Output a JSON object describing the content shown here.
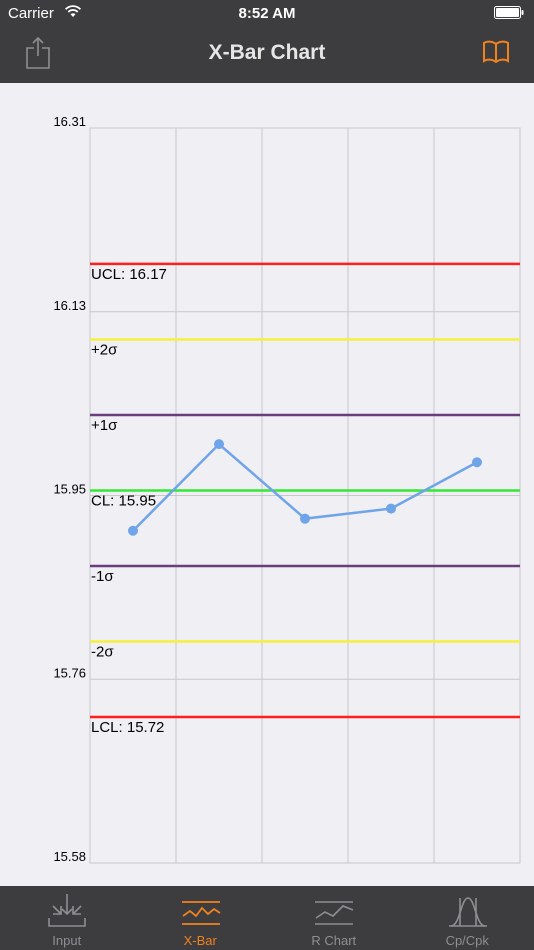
{
  "status_bar": {
    "carrier": "Carrier",
    "time": "8:52 AM"
  },
  "nav": {
    "title": "X-Bar Chart",
    "left_icon": "share-icon",
    "right_icon": "book-icon"
  },
  "chart_data": {
    "type": "line",
    "title": "",
    "y_ticks": [
      "16.31",
      "16.13",
      "15.95",
      "15.76",
      "15.58"
    ],
    "ylim": [
      15.58,
      16.31
    ],
    "x": [
      1,
      2,
      3,
      4,
      5
    ],
    "values": [
      15.91,
      15.996,
      15.922,
      15.932,
      15.978
    ],
    "grid": true,
    "control_lines": [
      {
        "label": "UCL: 16.17",
        "value": 16.175,
        "color": "#ff1f1f"
      },
      {
        "label": "+2σ",
        "value": 16.1,
        "color": "#f5f03c"
      },
      {
        "label": "+1σ",
        "value": 16.025,
        "color": "#6a3d7e"
      },
      {
        "label": "CL: 15.95",
        "value": 15.95,
        "color": "#35e835"
      },
      {
        "label": "-1σ",
        "value": 15.875,
        "color": "#6a3d7e"
      },
      {
        "label": "-2σ",
        "value": 15.8,
        "color": "#f5f03c"
      },
      {
        "label": "LCL: 15.72",
        "value": 15.725,
        "color": "#ff1f1f"
      }
    ],
    "series_color": "#6fa4e8"
  },
  "tabs": [
    {
      "label": "Input",
      "icon": "input-icon",
      "active": false
    },
    {
      "label": "X-Bar",
      "icon": "xbar-chart-icon",
      "active": true
    },
    {
      "label": "R Chart",
      "icon": "r-chart-icon",
      "active": false
    },
    {
      "label": "Cp/Cpk",
      "icon": "cpk-curve-icon",
      "active": false
    }
  ],
  "colors": {
    "bar_bg": "#3d3d3f",
    "accent": "#f0821e",
    "inactive": "#8e8e93",
    "page_bg": "#efeff4"
  }
}
